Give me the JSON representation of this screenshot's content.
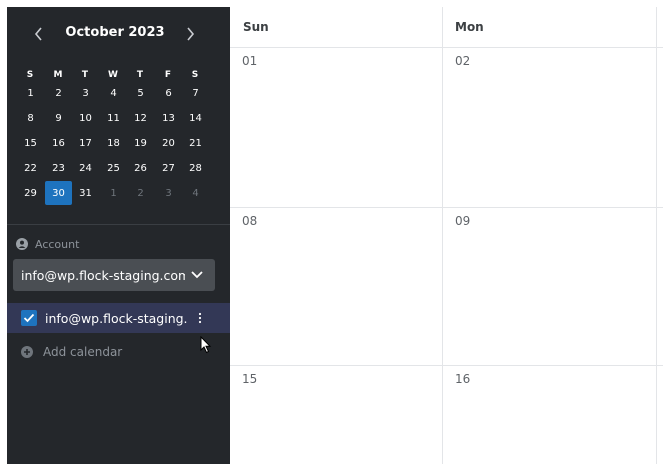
{
  "mini_calendar": {
    "month_title": "October 2023",
    "prev_icon": "chevron-left-icon",
    "next_icon": "chevron-right-icon",
    "weekdays": [
      "S",
      "M",
      "T",
      "W",
      "T",
      "F",
      "S"
    ],
    "weeks": [
      [
        "1",
        "2",
        "3",
        "4",
        "5",
        "6",
        "7"
      ],
      [
        "8",
        "9",
        "10",
        "11",
        "12",
        "13",
        "14"
      ],
      [
        "15",
        "16",
        "17",
        "18",
        "19",
        "20",
        "21"
      ],
      [
        "22",
        "23",
        "24",
        "25",
        "26",
        "27",
        "28"
      ],
      [
        "29",
        "30",
        "31",
        "1",
        "2",
        "3",
        "4"
      ]
    ],
    "selected_day": "30",
    "selected_color": "#1e73be"
  },
  "account": {
    "label": "Account",
    "label_icon": "user-circle-icon",
    "selected": "info@wp.flock-staging.com",
    "dropdown_icon": "chevron-down-icon"
  },
  "calendars": {
    "items": [
      {
        "name": "info@wp.flock-staging...",
        "checked": true,
        "color": "#1e73be",
        "more_icon": "more-vertical-icon"
      }
    ],
    "add_label": "Add calendar",
    "add_icon": "plus-circle-icon"
  },
  "grid": {
    "columns": [
      "Sun",
      "Mon"
    ],
    "rows": [
      [
        "01",
        "02"
      ],
      [
        "08",
        "09"
      ],
      [
        "15",
        "16"
      ]
    ]
  }
}
